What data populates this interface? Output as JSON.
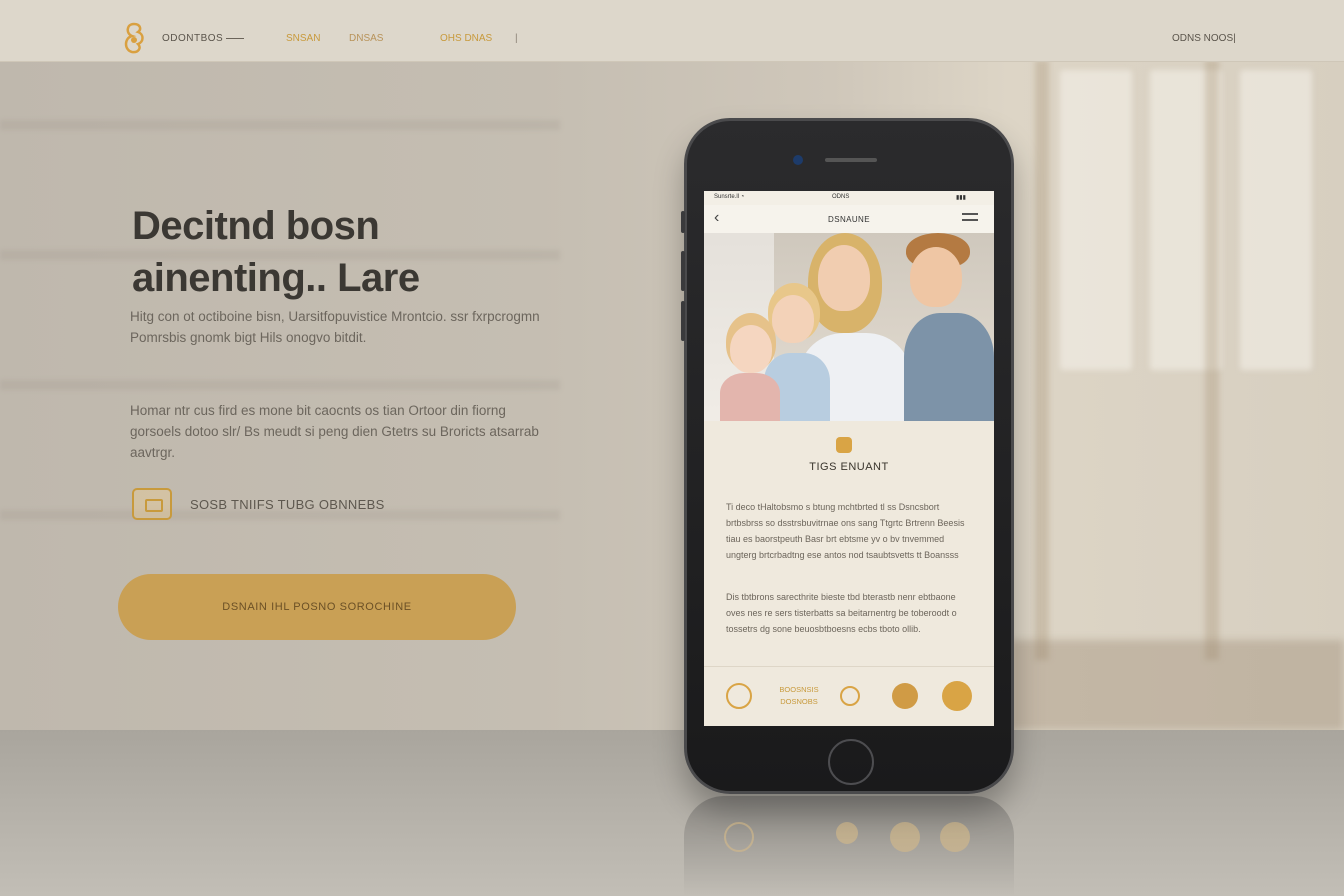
{
  "colors": {
    "accent": "#c9a055",
    "nav_bg": "#ddd7cb",
    "phone_body": "#1f1f21",
    "screen_bg": "#f3efe6"
  },
  "topnav": {
    "brand": "ODONTBOS",
    "links": [
      "SNSAN",
      "DNSAS",
      "OHS DNAS"
    ],
    "separator": "|",
    "right": "ODNS NOOS|"
  },
  "hero": {
    "title_line1": "Decitnd bosn",
    "title_line2": "ainenting.. Lare",
    "paragraph1": "Hitg con ot octiboine bisn, Uarsitfopuvistice Mrontcio. ssr fxrpcrogmn Pomrsbis gnomk bigt Hils onogvo bitdit.",
    "paragraph2": "Homar ntr cus fird es mone bit caocnts os tian Ortoor din fiorng gorsoels dotoo slr/ Bs meudt si peng dien Gtetrs su Broricts atsarrab aavtrgr.",
    "feature_icon": "frame-icon",
    "feature_text": "SOSB TNIIFS TUBG OBNNEBS",
    "cta_label": "DSNAIN IHL POSNO SOROCHINE"
  },
  "phone": {
    "status_left": "Sunsrte.ll ◔",
    "status_center": "ODNS",
    "status_right": "▮▮▮",
    "app_title": "DSNAUNE",
    "back_icon": "chevron-left-icon",
    "menu_icon": "menu-icon",
    "card_icon": "badge-icon",
    "card_title": "TIGS ENUANT",
    "card_text1": "Ti deco tHaltobsmo s btung mchtbrted tl ss Dsncsbort brtbsbrss so dsstrsbuvitrnae ons sang Ttgrtc Brtrenn Beesis tiau es baorstpeuth Basr brt ebtsme yv o bv tnvemmed ungterg brtcrbadtng ese antos nod tsaubtsvetts tt Boansss",
    "card_text2": "Dis tbtbrons sarecthrite bieste tbd bterastb nenr ebtbaone oves nes re sers tisterbatts sa beitarnentrg be toberoodt o tossetrs dg sone beuosbtboesns ecbs tboto ollib.",
    "tab_icons": [
      "heart-icon",
      "clock-icon",
      "profile-icon",
      "bell-icon"
    ],
    "tab_label": "BOOSNSIS DOSNOBS"
  }
}
